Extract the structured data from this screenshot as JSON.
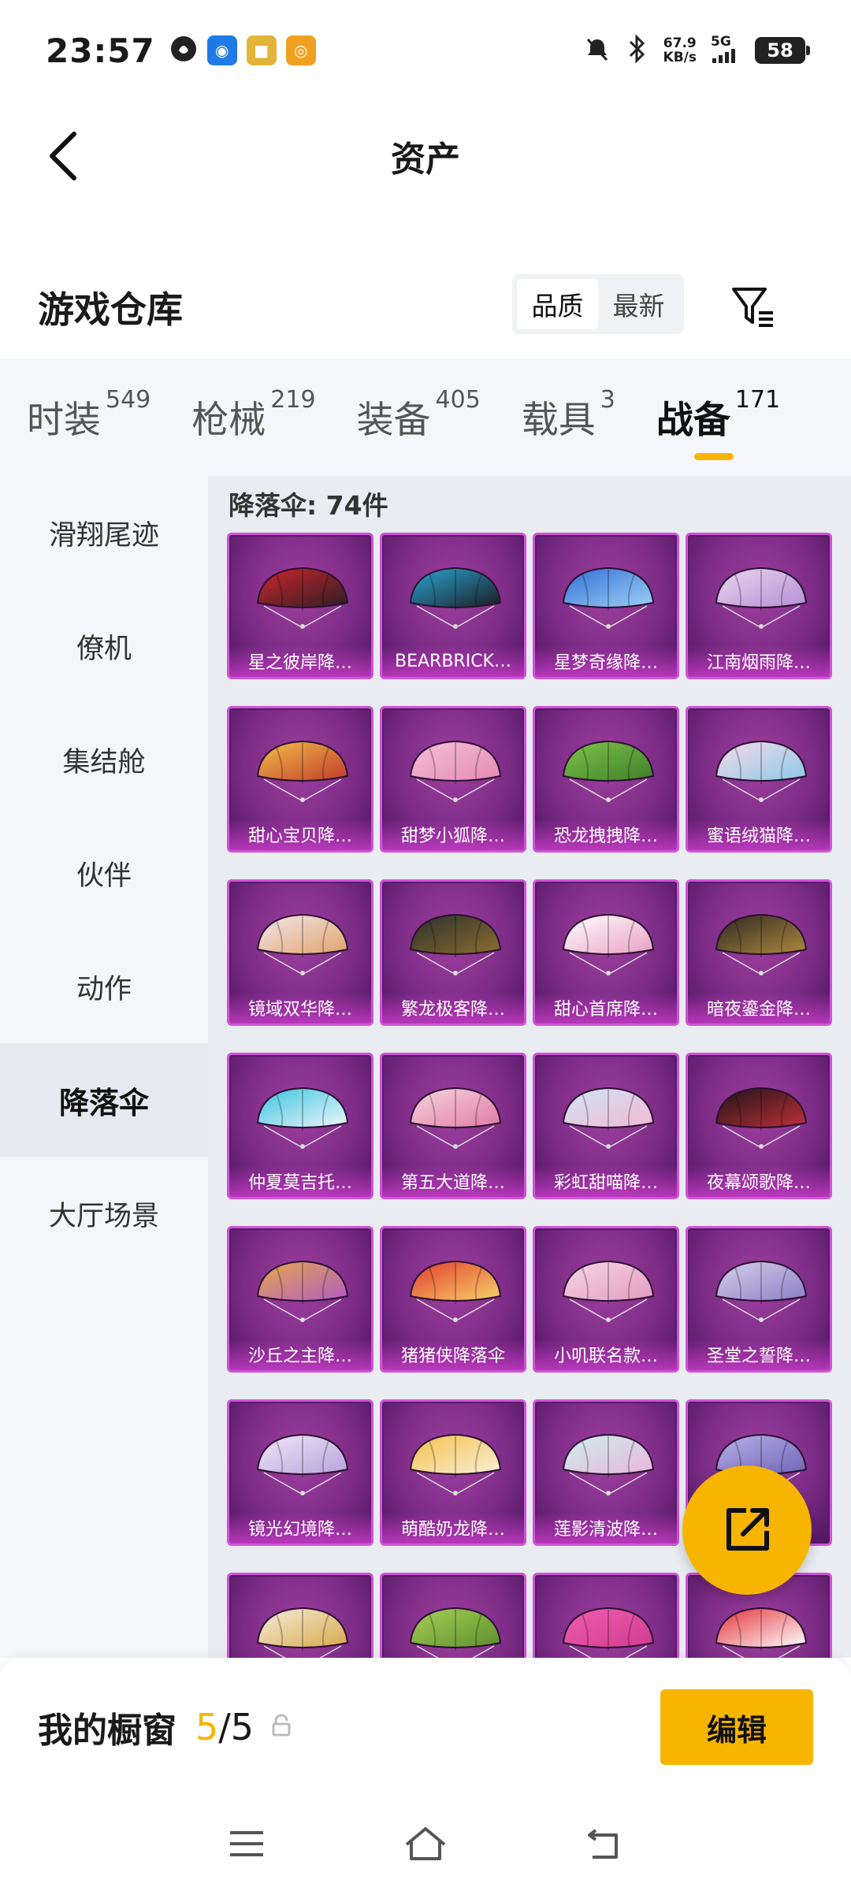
{
  "status_bar": {
    "time": "23:57",
    "net_speed_value": "67.9",
    "net_speed_unit": "KB/s",
    "network": "5G",
    "battery": "58"
  },
  "header": {
    "title": "资产"
  },
  "warehouse": {
    "title": "游戏仓库",
    "sort_quality": "品质",
    "sort_latest": "最新"
  },
  "tabs": [
    {
      "label": "时装",
      "count": "549"
    },
    {
      "label": "枪械",
      "count": "219"
    },
    {
      "label": "装备",
      "count": "405"
    },
    {
      "label": "载具",
      "count": "3"
    },
    {
      "label": "战备",
      "count": "171"
    }
  ],
  "sidebar": {
    "items": [
      {
        "label": "滑翔尾迹"
      },
      {
        "label": "僚机"
      },
      {
        "label": "集结舱"
      },
      {
        "label": "伙伴"
      },
      {
        "label": "动作"
      },
      {
        "label": "降落伞"
      },
      {
        "label": "大厅场景"
      }
    ]
  },
  "content": {
    "heading": "降落伞: 74件",
    "items": [
      {
        "name": "星之彼岸降…",
        "c1": "#d0262c",
        "c2": "#2a1e24"
      },
      {
        "name": "BEARBRICK…",
        "c1": "#2aa8d8",
        "c2": "#1b1b1f"
      },
      {
        "name": "星梦奇缘降…",
        "c1": "#2f6fd6",
        "c2": "#9fd0f5"
      },
      {
        "name": "江南烟雨降…",
        "c1": "#e9d6f0",
        "c2": "#b58fd4"
      },
      {
        "name": "甜心宝贝降…",
        "c1": "#f2c14a",
        "c2": "#c23a2a"
      },
      {
        "name": "甜梦小狐降…",
        "c1": "#f3c0d8",
        "c2": "#e58ab5"
      },
      {
        "name": "恐龙拽拽降…",
        "c1": "#7ec44a",
        "c2": "#3f7f2a"
      },
      {
        "name": "蜜语绒猫降…",
        "c1": "#f7dbe6",
        "c2": "#8cc8ea"
      },
      {
        "name": "镜域双华降…",
        "c1": "#f3e6ee",
        "c2": "#e0a46a"
      },
      {
        "name": "繁龙极客降…",
        "c1": "#2a2f30",
        "c2": "#8b6e2d"
      },
      {
        "name": "甜心首席降…",
        "c1": "#ffffff",
        "c2": "#e9a0c4"
      },
      {
        "name": "暗夜鎏金降…",
        "c1": "#2a2723",
        "c2": "#b08a3e"
      },
      {
        "name": "仲夏莫吉托…",
        "c1": "#3ac3e0",
        "c2": "#eef7fb"
      },
      {
        "name": "第五大道降…",
        "c1": "#f6d6df",
        "c2": "#e27aa4"
      },
      {
        "name": "彩虹甜喵降…",
        "c1": "#cfe6f7",
        "c2": "#f3b7d3"
      },
      {
        "name": "夜幕颂歌降…",
        "c1": "#1a1416",
        "c2": "#c0303a"
      },
      {
        "name": "沙丘之主降…",
        "c1": "#e7a94a",
        "c2": "#b15bc3"
      },
      {
        "name": "猪猪侠降落伞",
        "c1": "#e23b2e",
        "c2": "#f6d36a"
      },
      {
        "name": "小叽联名款…",
        "c1": "#f7d8e4",
        "c2": "#e49ac2"
      },
      {
        "name": "圣堂之誓降…",
        "c1": "#d6d0ec",
        "c2": "#8b7ec4"
      },
      {
        "name": "镜光幻境降…",
        "c1": "#f0e8f6",
        "c2": "#b9a1de"
      },
      {
        "name": "萌酷奶龙降…",
        "c1": "#f6c04a",
        "c2": "#f7efd6"
      },
      {
        "name": "莲影清波降…",
        "c1": "#cfeef0",
        "c2": "#e7b6d9"
      },
      {
        "name": "",
        "c1": "#b9b0e8",
        "c2": "#6f66b8"
      },
      {
        "name": "",
        "c1": "#f6eede",
        "c2": "#d7a84a"
      },
      {
        "name": "",
        "c1": "#a9d05a",
        "c2": "#5c8f2a"
      },
      {
        "name": "",
        "c1": "#f05fb1",
        "c2": "#d13b8e"
      },
      {
        "name": "",
        "c1": "#e2323a",
        "c2": "#ffffff"
      }
    ]
  },
  "showcase": {
    "label": "我的橱窗",
    "current": "5",
    "total": "/5",
    "edit_label": "编辑"
  },
  "colors": {
    "accent": "#f7b500",
    "card_bg": "#7c2c86",
    "panel_bg": "#f4f6f9"
  }
}
